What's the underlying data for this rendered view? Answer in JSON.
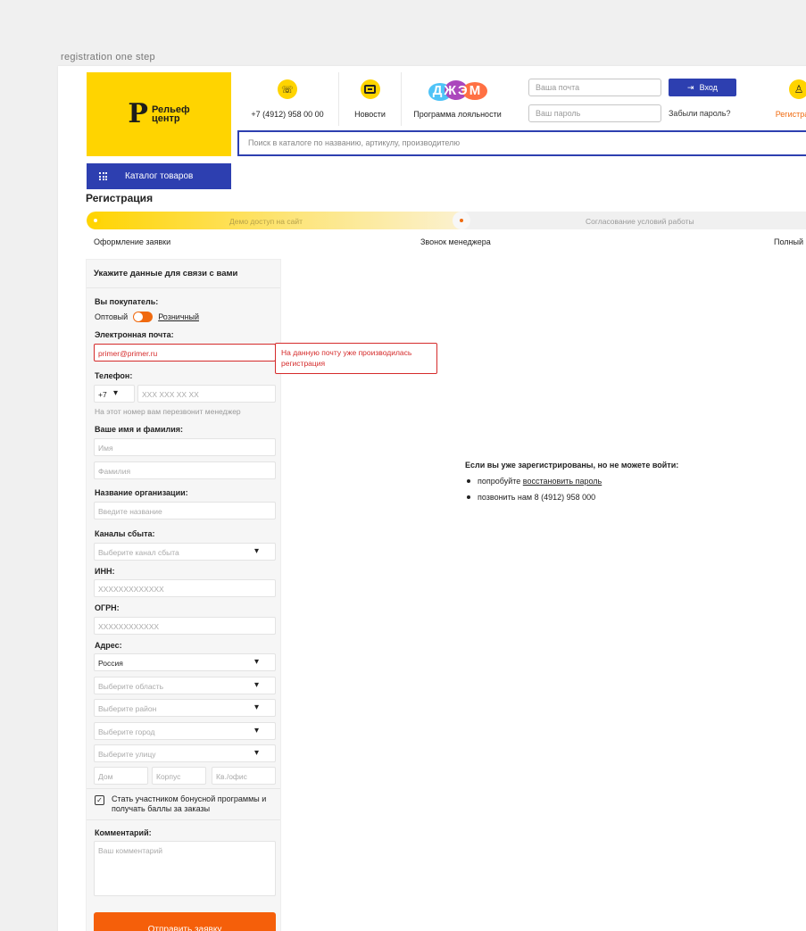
{
  "artboard_label": "registration one step",
  "header": {
    "logo": {
      "mark": "Р",
      "line1": "Рельеф",
      "line2": "центр"
    },
    "phone": "+7 (4912) 958 00 00",
    "news": "Новости",
    "loyalty": "Программа лояльности",
    "loyalty_logo": "ДЖЭМ",
    "email_placeholder": "Ваша почта",
    "password_placeholder": "Ваш пароль",
    "login_button": "Вход",
    "forgot_password": "Забыли пароль?",
    "register": "Регистрация",
    "search_placeholder": "Поиск в каталоге по названию, артикулу, производителю",
    "catalog_button": "Каталог товаров"
  },
  "page": {
    "title": "Регистрация",
    "progress": {
      "segment1": "Демо доступ на сайт",
      "segment2": "Согласование условий работы",
      "steps": [
        "Оформление заявки",
        "Звонок менеджера",
        "Полный"
      ]
    }
  },
  "form": {
    "heading": "Укажите данные для связи с вами",
    "buyer_label": "Вы покупатель:",
    "buyer_wholesale": "Оптовый",
    "buyer_retail": "Розничный",
    "email_label": "Электронная почта:",
    "email_value": "primer@primer.ru",
    "email_error": "На данную почту уже производилась регистрация",
    "phone_label": "Телефон:",
    "phone_code": "+7",
    "phone_placeholder": "XXX XXX XX XX",
    "phone_hint": "На этот номер вам перезвонит менеджер",
    "name_label": "Ваше имя и фамилия:",
    "first_name_placeholder": "Имя",
    "last_name_placeholder": "Фамилия",
    "org_label": "Название организации:",
    "org_placeholder": "Введите название",
    "channels_label": "Каналы сбыта:",
    "channels_placeholder": "Выберите канал сбыта",
    "inn_label": "ИНН:",
    "inn_placeholder": "XXXXXXXXXXXXX",
    "ogrn_label": "ОГРН:",
    "ogrn_placeholder": "XXXXXXXXXXXX",
    "address_label": "Адрес:",
    "country_value": "Россия",
    "region_placeholder": "Выберите область",
    "district_placeholder": "Выберите район",
    "city_placeholder": "Выберите город",
    "street_placeholder": "Выберите улицу",
    "house_placeholder": "Дом",
    "building_placeholder": "Корпус",
    "apartment_placeholder": "Кв./офис",
    "bonus_checkbox": "Стать участником бонусной программы и получать баллы за заказы",
    "comment_label": "Комментарий:",
    "comment_placeholder": "Ваш комментарий",
    "submit": "Отправить заявку"
  },
  "info": {
    "title": "Если вы уже зарегистрированы, но не можете войти:",
    "item1_prefix": "попробуйте",
    "item1_link": "восстановить пароль",
    "item2": "позвонить нам 8 (4912) 958 000"
  },
  "colors": {
    "brand_yellow": "#ffd400",
    "brand_blue": "#2d3fb0",
    "accent_orange": "#f55f0a",
    "error_red": "#d52b2b"
  }
}
